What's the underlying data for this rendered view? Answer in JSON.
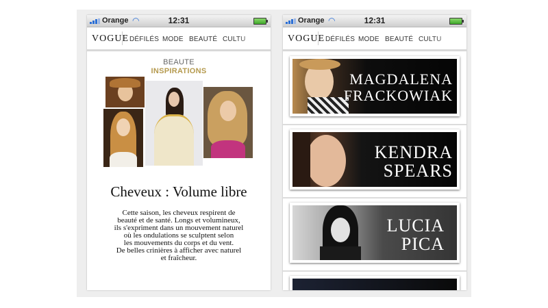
{
  "status_bar": {
    "carrier": "Orange",
    "time": "12:31"
  },
  "nav": {
    "logo": "VOGUE",
    "items": [
      "DÉFILÉS",
      "MODE",
      "BEAUTÉ",
      "CULTU"
    ]
  },
  "left_screen": {
    "section": "BEAUTE",
    "subsection": "INSPIRATIONS",
    "headline": "Cheveux : Volume libre",
    "body_lines": [
      "Cette saison, les cheveux respirent de",
      "beauté et de santé. Longs et volumineux,",
      "ils s'expriment dans un mouvement naturel",
      "où les ondulations se sculptent selon",
      "les mouvements du corps et du vent.",
      "De belles crinières à afficher avec naturel",
      "et fraîcheur."
    ]
  },
  "right_screen": {
    "banners": [
      {
        "line1": "MAGDALENA",
        "line2": "FRACKOWIAK"
      },
      {
        "line1": "KENDRA",
        "line2": "SPEARS"
      },
      {
        "line1": "LUCIA",
        "line2": "PICA"
      }
    ]
  },
  "icons": [
    "signal-icon",
    "wifi-icon",
    "battery-icon"
  ],
  "colors": {
    "accent_gold": "#b59a4e",
    "signal_blue": "#2b6fd6",
    "battery_green": "#3fa82a"
  }
}
